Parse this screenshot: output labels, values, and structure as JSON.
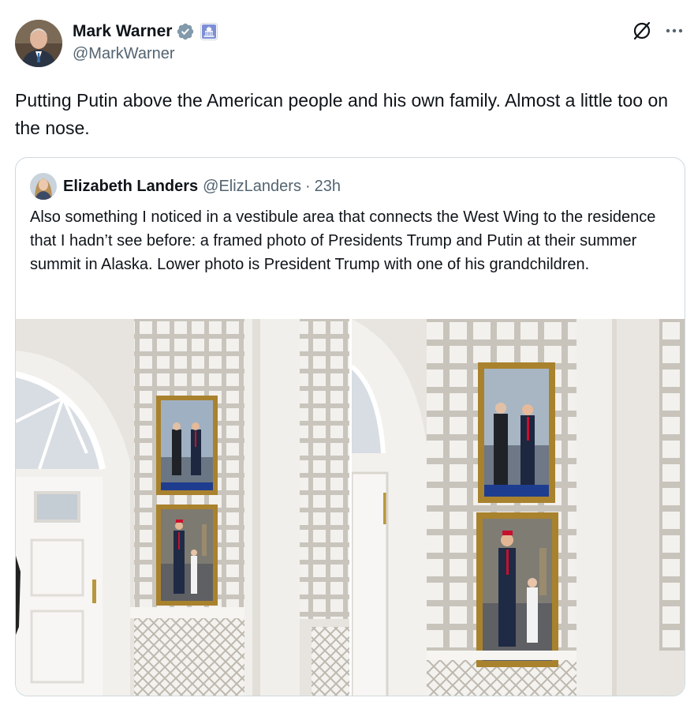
{
  "author": {
    "name": "Mark Warner",
    "handle": "@MarkWarner",
    "avatar_icon": "author-avatar",
    "verified_icon": "verified-badge-icon",
    "affiliation_icon": "us-government-capitol-icon"
  },
  "actions": {
    "grok_icon": "grok-icon",
    "more_icon": "more-options-icon"
  },
  "tweet": {
    "text": "Putting Putin above the American people and his own family. Almost a little too on the nose."
  },
  "quoted": {
    "name": "Elizabeth Landers",
    "handle": "@ElizLanders",
    "separator": "·",
    "time": "23h",
    "text": "Also something I noticed in a vestibule area that connects the West Wing to the residence that I hadn’t see before: a framed photo of Presidents Trump and Putin at their summer summit in Alaska. Lower photo is President Trump with one of his grandchildren.",
    "media": [
      "photo-left",
      "photo-right"
    ]
  },
  "colors": {
    "text_primary": "#0f1419",
    "text_secondary": "#536471",
    "border": "#cfd9de",
    "verified_blue": "#829aab",
    "frame_gold": "#a9822e"
  }
}
